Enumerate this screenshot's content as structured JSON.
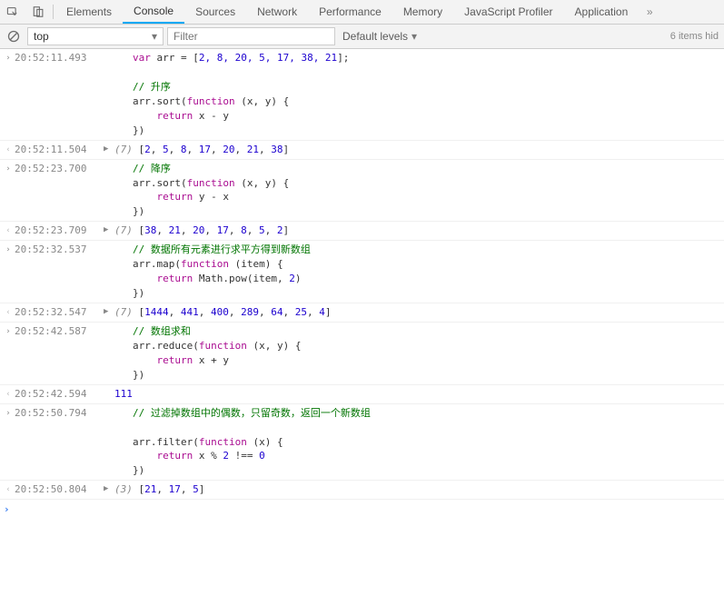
{
  "toolbar": {
    "tabs": [
      "Elements",
      "Console",
      "Sources",
      "Network",
      "Performance",
      "Memory",
      "JavaScript Profiler",
      "Application"
    ]
  },
  "filterBar": {
    "context": "top",
    "filterPlaceholder": "Filter",
    "levels": "Default levels",
    "hidden": "6 items hid"
  },
  "entries": [
    {
      "ts": "20:52:11.493",
      "type": "input",
      "code": {
        "l1a": "var",
        "l1b": " arr = [",
        "l1nums": "2, 8, 20, 5, 17, 38, 21",
        "l1c": "];",
        "c1": "// 升序",
        "l2a": "arr.sort(",
        "l2b": "function",
        "l2c": " (x, y) {",
        "l3a": "    ",
        "l3b": "return",
        "l3c": " x - y",
        "l4": "})"
      }
    },
    {
      "ts": "20:52:11.504",
      "type": "output",
      "len": "(7)",
      "vals": "[2, 5, 8, 17, 20, 21, 38]"
    },
    {
      "ts": "20:52:23.700",
      "type": "input",
      "code": {
        "c1": "// 降序",
        "l2a": "arr.sort(",
        "l2b": "function",
        "l2c": " (x, y) {",
        "l3a": "    ",
        "l3b": "return",
        "l3c": " y - x",
        "l4": "})"
      }
    },
    {
      "ts": "20:52:23.709",
      "type": "output",
      "len": "(7)",
      "vals": "[38, 21, 20, 17, 8, 5, 2]"
    },
    {
      "ts": "20:52:32.537",
      "type": "input",
      "code": {
        "c1": "// 数据所有元素进行求平方得到新数组",
        "l2a": "arr.map(",
        "l2b": "function",
        "l2c": " (item) {",
        "l3a": "    ",
        "l3b": "return",
        "l3c": " Math.pow(item, ",
        "l3n": "2",
        "l3d": ")",
        "l4": "})"
      }
    },
    {
      "ts": "20:52:32.547",
      "type": "output",
      "len": "(7)",
      "vals": "[1444, 441, 400, 289, 64, 25, 4]"
    },
    {
      "ts": "20:52:42.587",
      "type": "input",
      "code": {
        "c1": "// 数组求和",
        "l2a": "arr.reduce(",
        "l2b": "function",
        "l2c": " (x, y) {",
        "l3a": "    ",
        "l3b": "return",
        "l3c": " x + y",
        "l4": "})"
      }
    },
    {
      "ts": "20:52:42.594",
      "type": "output-plain",
      "val": "111"
    },
    {
      "ts": "20:52:50.794",
      "type": "input",
      "code": {
        "c1": "// 过滤掉数组中的偶数，只留奇数，返回一个新数组",
        "l2a": "arr.filter(",
        "l2b": "function",
        "l2c": " (x) {",
        "l3a": "    ",
        "l3b": "return",
        "l3c": " x % ",
        "l3n": "2",
        "l3d": " !== ",
        "l3n2": "0",
        "l4": "})"
      }
    },
    {
      "ts": "20:52:50.804",
      "type": "output",
      "len": "(3)",
      "vals": "[21, 17, 5]"
    }
  ]
}
